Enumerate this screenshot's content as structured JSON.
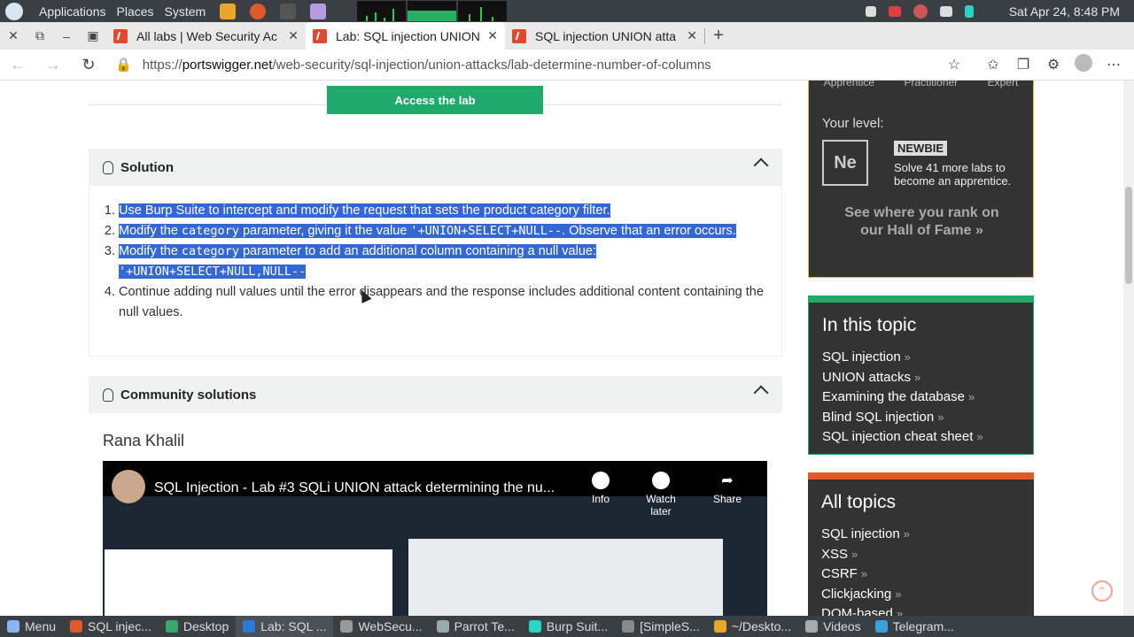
{
  "os_bar": {
    "menus": [
      "Applications",
      "Places",
      "System"
    ],
    "datetime": "Sat Apr 24,  8:48 PM"
  },
  "tabs": [
    {
      "title": "All labs | Web Security Ac",
      "active": false
    },
    {
      "title": "Lab: SQL injection UNION",
      "active": true
    },
    {
      "title": "SQL injection UNION atta",
      "active": false
    }
  ],
  "address": {
    "prefix": "https://",
    "domain": "portswigger.net",
    "path": "/web-security/sql-injection/union-attacks/lab-determine-number-of-columns"
  },
  "main": {
    "access_button": "Access the lab",
    "solution": {
      "heading": "Solution",
      "steps": [
        {
          "parts": [
            {
              "t": "Use Burp Suite to intercept and modify the request that sets the product category filter."
            }
          ]
        },
        {
          "parts": [
            {
              "t": "Modify the "
            },
            {
              "c": "category"
            },
            {
              "t": " parameter, giving it the value "
            },
            {
              "c": "'+UNION+SELECT+NULL--"
            },
            {
              "t": ". Observe that an error occurs."
            }
          ]
        },
        {
          "parts": [
            {
              "t": "Modify the "
            },
            {
              "c": "category"
            },
            {
              "t": " parameter to add an additional column containing a null value: "
            },
            {
              "c": "'+UNION+SELECT+NULL,NULL--"
            }
          ]
        },
        {
          "parts": [
            {
              "t": "Continue adding null values until the error disappears and the response includes additional content containing the null values."
            }
          ]
        }
      ]
    },
    "community": {
      "heading": "Community solutions",
      "author": "Rana Khalil",
      "video_title": "SQL Injection - Lab #3 SQLi UNION attack determining the nu...",
      "video_actions": [
        "Info",
        "Watch later",
        "Share"
      ]
    }
  },
  "sidebar": {
    "levels": [
      "Apprentice",
      "Practitioner",
      "Expert"
    ],
    "your_level_label": "Your level:",
    "level_short": "Ne",
    "level_badge": "NEWBIE",
    "level_message": "Solve 41 more labs to become an apprentice.",
    "rank_text": "See where you rank on our Hall of Fame",
    "in_this_topic": {
      "heading": "In this topic",
      "items": [
        "SQL injection",
        "UNION attacks",
        "Examining the database",
        "Blind SQL injection",
        "SQL injection cheat sheet"
      ]
    },
    "all_topics": {
      "heading": "All topics",
      "items": [
        "SQL injection",
        "XSS",
        "CSRF",
        "Clickjacking",
        "DOM-based"
      ]
    }
  },
  "taskbar": {
    "items": [
      {
        "label": "Menu"
      },
      {
        "label": "SQL injec..."
      },
      {
        "label": "Desktop"
      },
      {
        "label": "Lab: SQL ..."
      },
      {
        "label": "WebSecu..."
      },
      {
        "label": "Parrot Te..."
      },
      {
        "label": "Burp Suit..."
      },
      {
        "label": "[SimpleS..."
      },
      {
        "label": "~/Deskto..."
      },
      {
        "label": "Videos"
      },
      {
        "label": "Telegram..."
      }
    ]
  }
}
